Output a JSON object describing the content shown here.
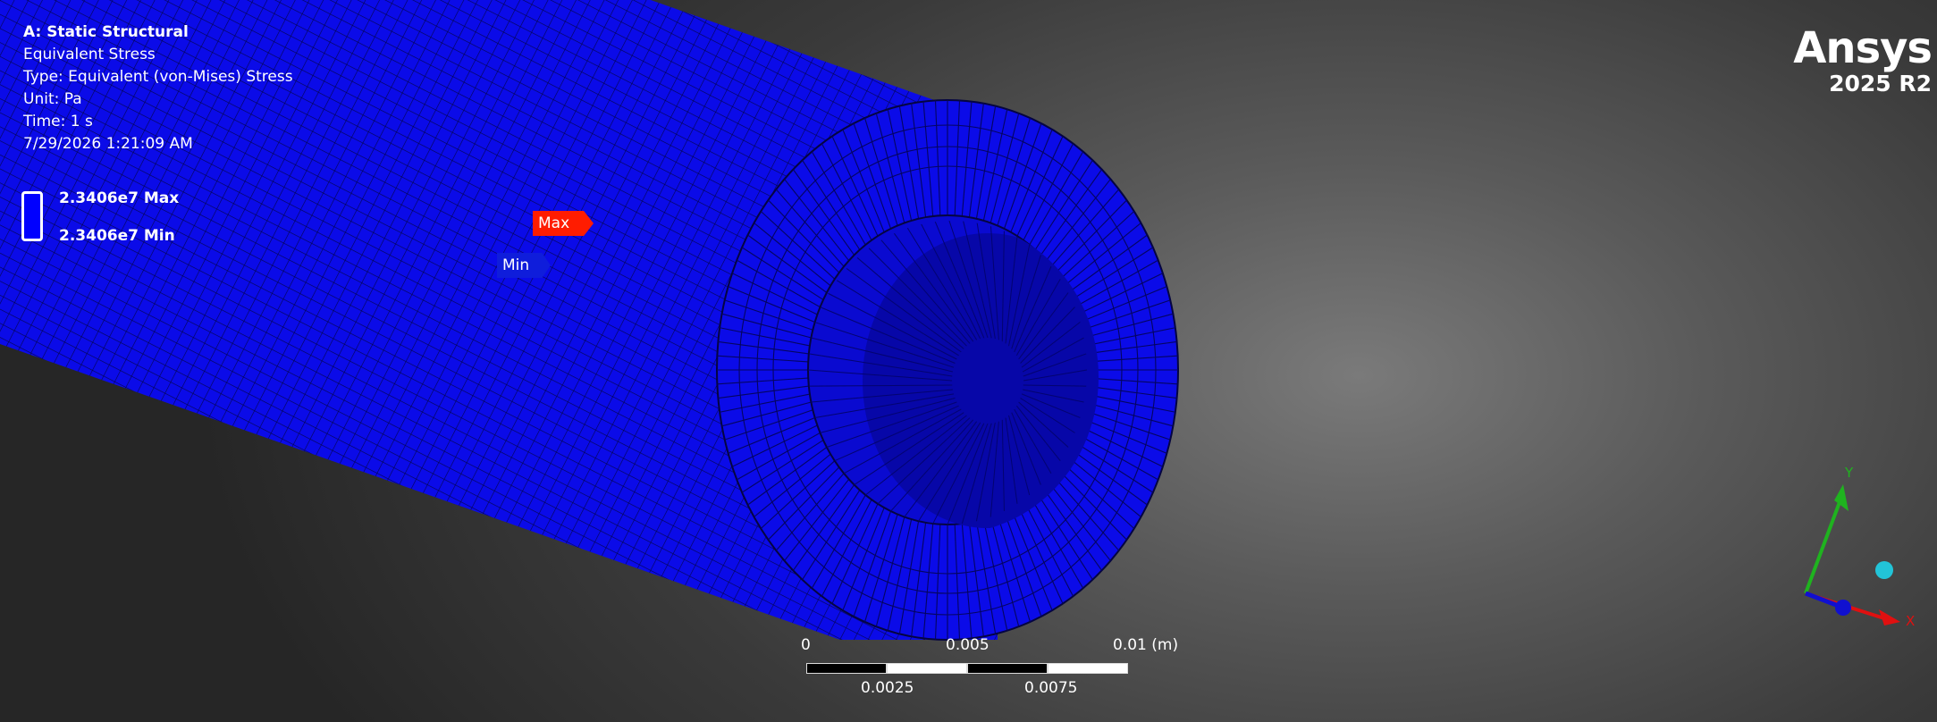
{
  "window": {
    "analysis_title": "A: Static Structural",
    "result_name": "Equivalent Stress",
    "result_type": "Type: Equivalent (von-Mises) Stress",
    "unit": "Unit: Pa",
    "time": "Time: 1 s",
    "timestamp": "7/29/2026 1:21:09 AM"
  },
  "legend": {
    "max_label": "2.3406e7 Max",
    "min_label": "2.3406e7 Min",
    "color": "#0000ff"
  },
  "probes": {
    "max": "Max",
    "min": "Min",
    "max_color": "#ff1c00",
    "min_color": "#0f1ddb"
  },
  "branding": {
    "name": "Ansys",
    "version": "2025 R2"
  },
  "scale_bar": {
    "top_labels": [
      "0",
      "0.005",
      "0.01 (m)"
    ],
    "bottom_labels": [
      "0.0025",
      "0.0075"
    ]
  },
  "triad": {
    "y_label": "Y",
    "x_label": "X",
    "y_color": "#1fb31f",
    "x_color": "#e01010",
    "z_color": "#1010d0",
    "iso_ball_color": "#22c4d8"
  },
  "model": {
    "mesh_color": "#0b0be8",
    "edge_color": "#050540"
  }
}
